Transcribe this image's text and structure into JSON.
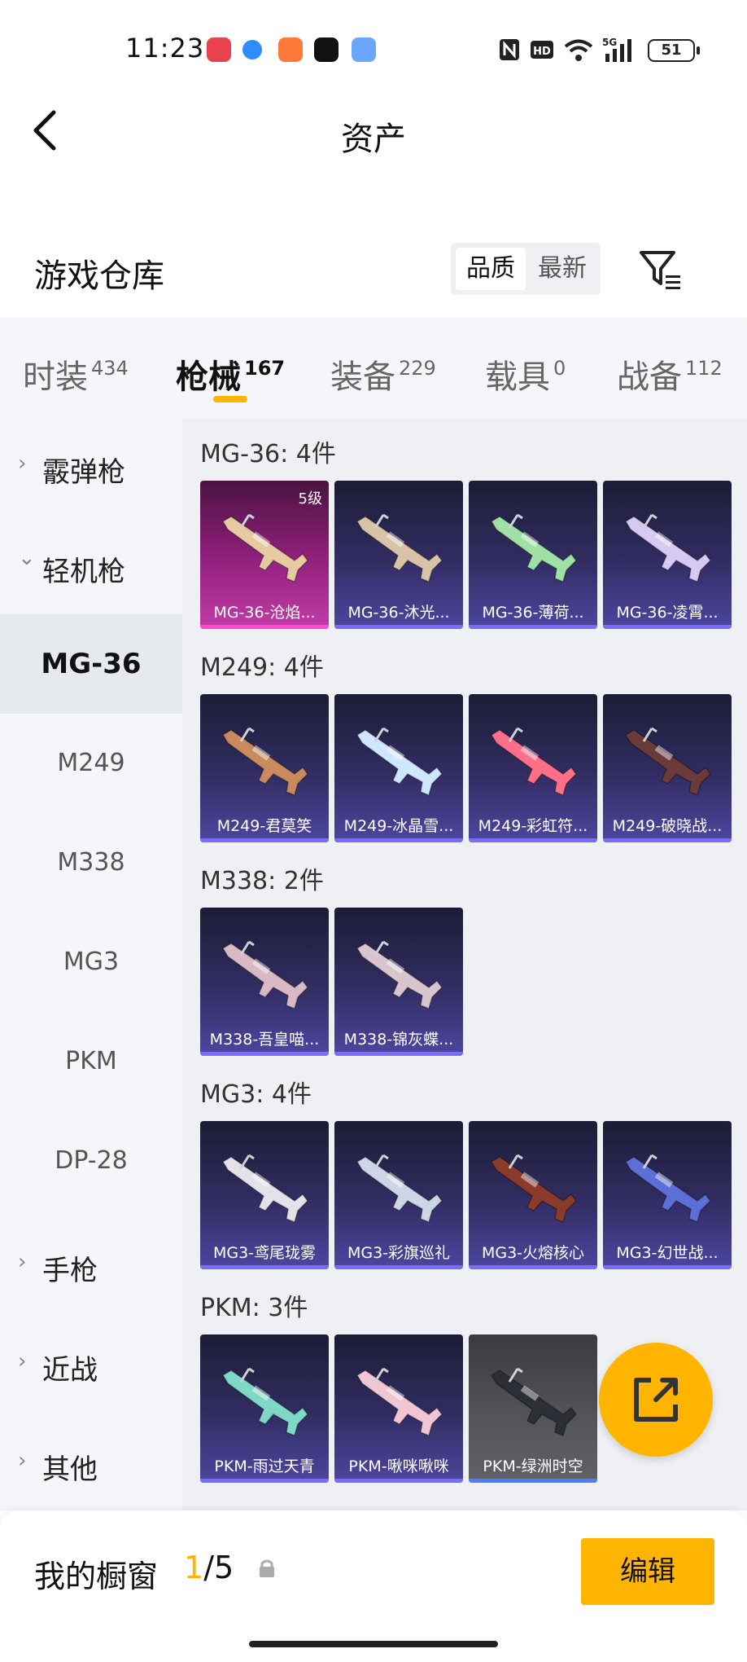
{
  "status_bar": {
    "time": "11:23",
    "battery": "51",
    "network": "5G"
  },
  "header": {
    "title": "资产"
  },
  "warehouse": {
    "title": "游戏仓库",
    "sort_options": [
      "品质",
      "最新"
    ],
    "active_sort": "品质"
  },
  "tabs": [
    {
      "label": "时装",
      "count": "434"
    },
    {
      "label": "枪械",
      "count": "167"
    },
    {
      "label": "装备",
      "count": "229"
    },
    {
      "label": "载具",
      "count": "0"
    },
    {
      "label": "战备",
      "count": "112"
    }
  ],
  "active_tab": "枪械",
  "sidebar": {
    "groups": [
      {
        "label": "霰弹枪",
        "expanded": false
      },
      {
        "label": "轻机枪",
        "expanded": true
      },
      {
        "label": "手枪",
        "expanded": false
      },
      {
        "label": "近战",
        "expanded": false
      },
      {
        "label": "其他",
        "expanded": false
      }
    ],
    "subitems": [
      "MG-36",
      "M249",
      "M338",
      "MG3",
      "PKM",
      "DP-28"
    ],
    "active_subitem": "MG-36"
  },
  "groups": [
    {
      "title": "MG-36: 4件",
      "items": [
        {
          "name": "MG-36-沧焰...",
          "level": "5级",
          "rarity": "pink"
        },
        {
          "name": "MG-36-沐光...",
          "rarity": "purple"
        },
        {
          "name": "MG-36-薄荷...",
          "rarity": "purple"
        },
        {
          "name": "MG-36-凌霄...",
          "rarity": "purple"
        }
      ]
    },
    {
      "title": "M249: 4件",
      "items": [
        {
          "name": "M249-君莫笑",
          "rarity": "purple"
        },
        {
          "name": "M249-冰晶雪...",
          "rarity": "purple"
        },
        {
          "name": "M249-彩虹符...",
          "rarity": "purple"
        },
        {
          "name": "M249-破晓战...",
          "rarity": "purple"
        }
      ]
    },
    {
      "title": "M338: 2件",
      "items": [
        {
          "name": "M338-吾皇喵...",
          "rarity": "purple"
        },
        {
          "name": "M338-锦灰蝶...",
          "rarity": "purple"
        }
      ]
    },
    {
      "title": "MG3: 4件",
      "items": [
        {
          "name": "MG3-鸢尾珑雾",
          "rarity": "purple"
        },
        {
          "name": "MG3-彩旗巡礼",
          "rarity": "purple"
        },
        {
          "name": "MG3-火熔核心",
          "rarity": "purple"
        },
        {
          "name": "MG3-幻世战...",
          "rarity": "purple"
        }
      ]
    },
    {
      "title": "PKM: 3件",
      "items": [
        {
          "name": "PKM-雨过天青",
          "rarity": "purple"
        },
        {
          "name": "PKM-啾咪啾咪",
          "rarity": "purple"
        },
        {
          "name": "PKM-绿洲时空",
          "rarity": "gray"
        }
      ]
    }
  ],
  "showcase": {
    "label": "我的橱窗",
    "current": "1",
    "total": "/5"
  },
  "edit_label": "编辑",
  "colors": {
    "accent": "#ffb400",
    "purple_card": "#322d63",
    "pink_card": "#c23ca8",
    "gray_card": "#55565c"
  }
}
